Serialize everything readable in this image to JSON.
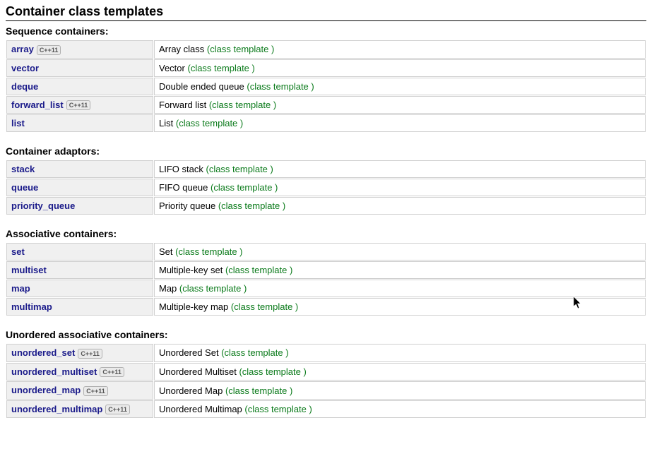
{
  "title": "Container class templates",
  "badge_label": "C++11",
  "sections": [
    {
      "heading": "Sequence containers:",
      "items": [
        {
          "name": "array",
          "badge": true,
          "desc": "Array class",
          "type": "(class template )"
        },
        {
          "name": "vector",
          "badge": false,
          "desc": "Vector",
          "type": "(class template )"
        },
        {
          "name": "deque",
          "badge": false,
          "desc": "Double ended queue",
          "type": "(class template )"
        },
        {
          "name": "forward_list",
          "badge": true,
          "desc": "Forward list",
          "type": "(class template )"
        },
        {
          "name": "list",
          "badge": false,
          "desc": "List",
          "type": "(class template )"
        }
      ]
    },
    {
      "heading": "Container adaptors:",
      "items": [
        {
          "name": "stack",
          "badge": false,
          "desc": "LIFO stack",
          "type": "(class template )"
        },
        {
          "name": "queue",
          "badge": false,
          "desc": "FIFO queue",
          "type": "(class template )"
        },
        {
          "name": "priority_queue",
          "badge": false,
          "desc": "Priority queue",
          "type": "(class template )"
        }
      ]
    },
    {
      "heading": "Associative containers:",
      "items": [
        {
          "name": "set",
          "badge": false,
          "desc": "Set",
          "type": "(class template )"
        },
        {
          "name": "multiset",
          "badge": false,
          "desc": "Multiple-key set",
          "type": "(class template )"
        },
        {
          "name": "map",
          "badge": false,
          "desc": "Map",
          "type": "(class template )"
        },
        {
          "name": "multimap",
          "badge": false,
          "desc": "Multiple-key map",
          "type": "(class template )"
        }
      ]
    },
    {
      "heading": "Unordered associative containers:",
      "items": [
        {
          "name": "unordered_set",
          "badge": true,
          "desc": "Unordered Set",
          "type": "(class template )"
        },
        {
          "name": "unordered_multiset",
          "badge": true,
          "desc": "Unordered Multiset",
          "type": "(class template )"
        },
        {
          "name": "unordered_map",
          "badge": true,
          "desc": "Unordered Map",
          "type": "(class template )"
        },
        {
          "name": "unordered_multimap",
          "badge": true,
          "desc": "Unordered Multimap",
          "type": "(class template )"
        }
      ]
    }
  ]
}
